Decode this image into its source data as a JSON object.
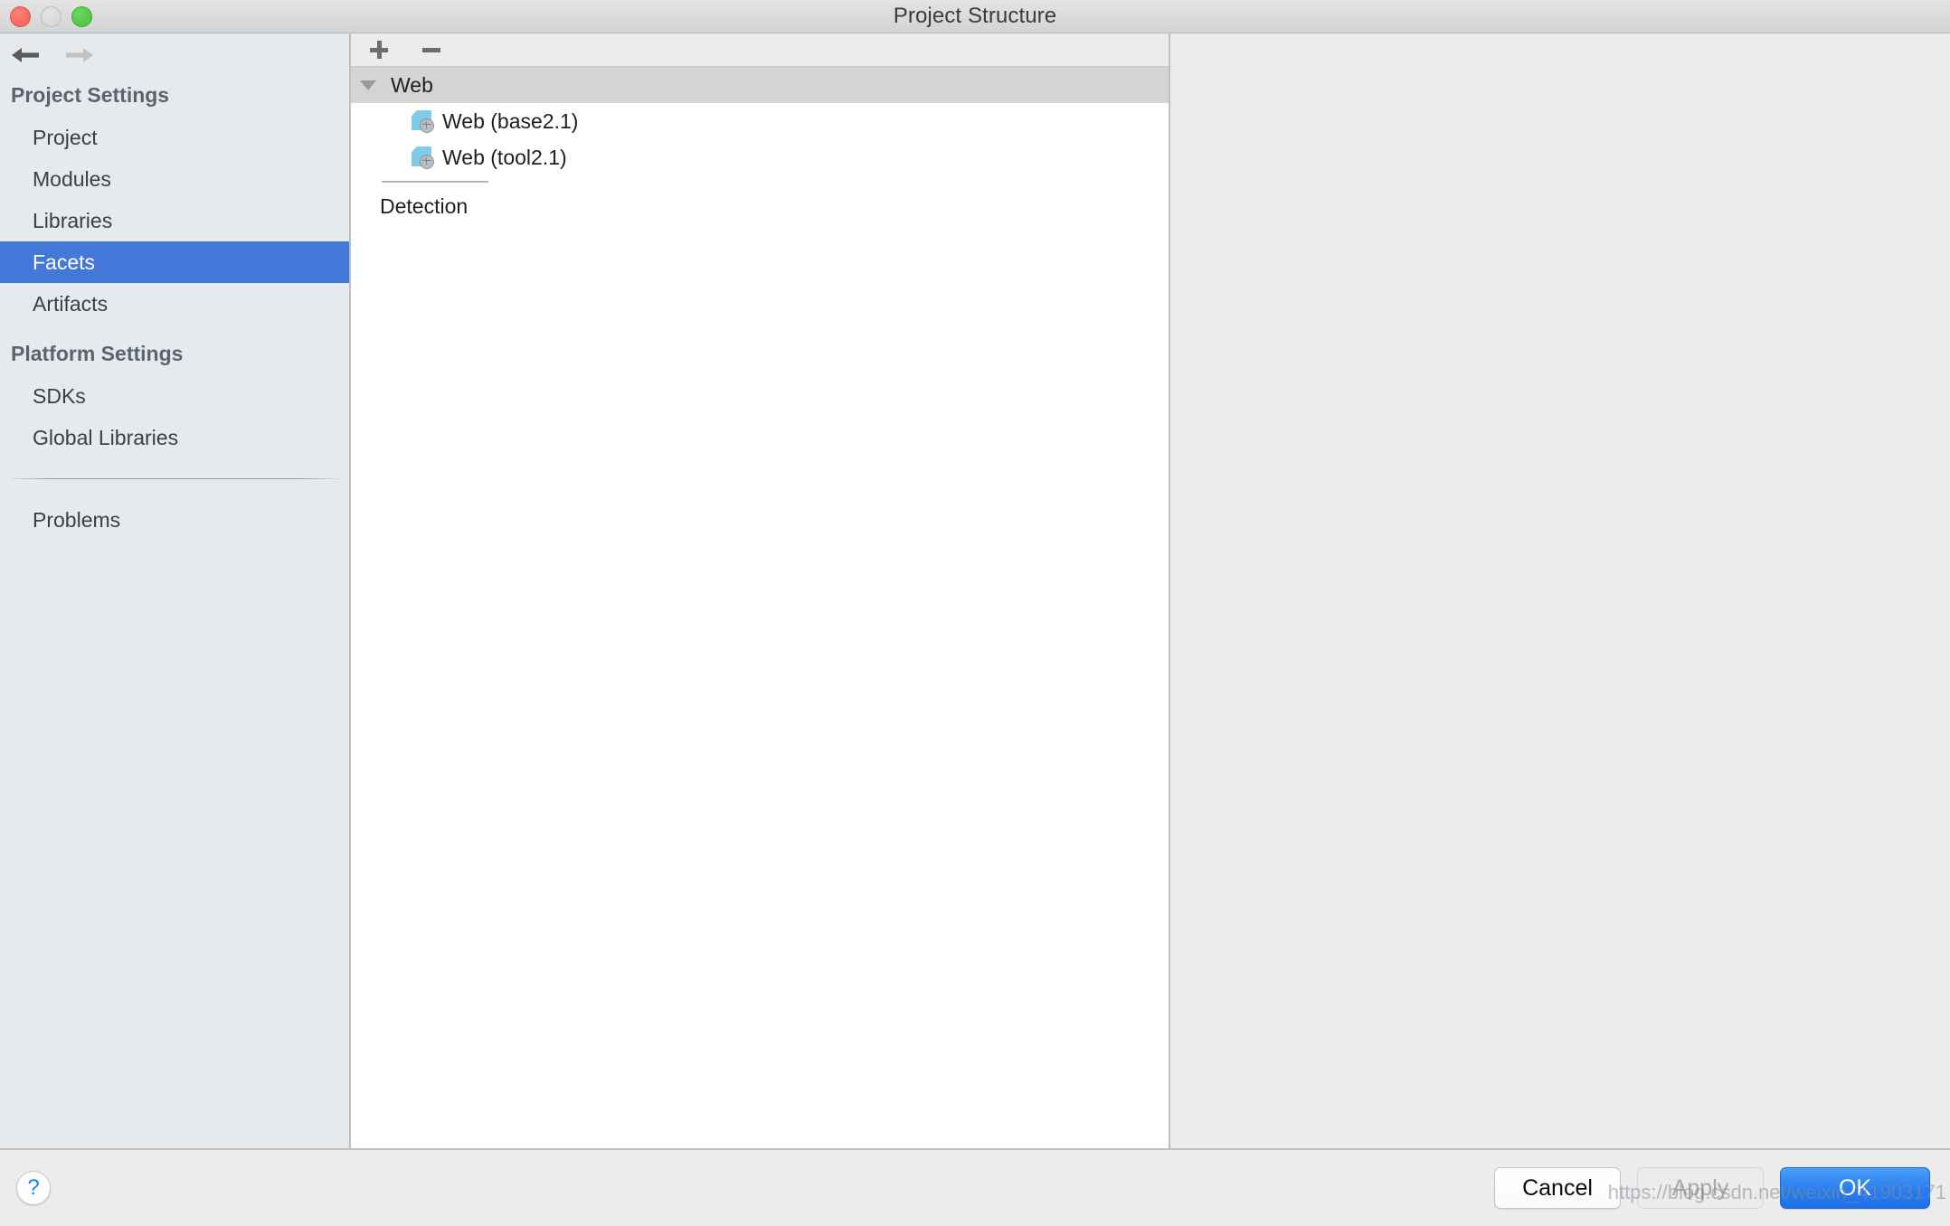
{
  "window": {
    "title": "Project Structure",
    "traffic_lights": [
      "close",
      "minimize",
      "maximize"
    ]
  },
  "nav": {
    "back_label": "back-arrow",
    "forward_label": "forward-arrow"
  },
  "sidebar": {
    "sections": [
      {
        "title": "Project Settings",
        "items": [
          {
            "label": "Project",
            "selected": false
          },
          {
            "label": "Modules",
            "selected": false
          },
          {
            "label": "Libraries",
            "selected": false
          },
          {
            "label": "Facets",
            "selected": true
          },
          {
            "label": "Artifacts",
            "selected": false
          }
        ]
      },
      {
        "title": "Platform Settings",
        "items": [
          {
            "label": "SDKs",
            "selected": false
          },
          {
            "label": "Global Libraries",
            "selected": false
          }
        ]
      }
    ],
    "extra_items": [
      {
        "label": "Problems",
        "selected": false
      }
    ]
  },
  "tree_toolbar": {
    "add_label": "+",
    "remove_label": "−"
  },
  "tree": {
    "group": {
      "label": "Web",
      "expanded": true,
      "selected": true
    },
    "children": [
      {
        "label": "Web (base2.1)",
        "icon": "web-facet-icon"
      },
      {
        "label": "Web (tool2.1)",
        "icon": "web-facet-icon"
      }
    ],
    "detection_label": "Detection"
  },
  "footer": {
    "help_label": "?",
    "buttons": [
      {
        "label": "Cancel",
        "kind": "default",
        "disabled": false
      },
      {
        "label": "Apply",
        "kind": "plain",
        "disabled": true
      },
      {
        "label": "OK",
        "kind": "primary",
        "disabled": false
      }
    ]
  },
  "watermark": "https://blog.csdn.net/weixin_41903171",
  "colors": {
    "selection_blue": "#4478d8",
    "ok_blue": "#2b7ef0",
    "sidebar_bg": "#e6eaed",
    "panel_bg": "#ececec",
    "facet_icon_blue": "#7fcbe8",
    "help_blue": "#1a7ef4"
  }
}
